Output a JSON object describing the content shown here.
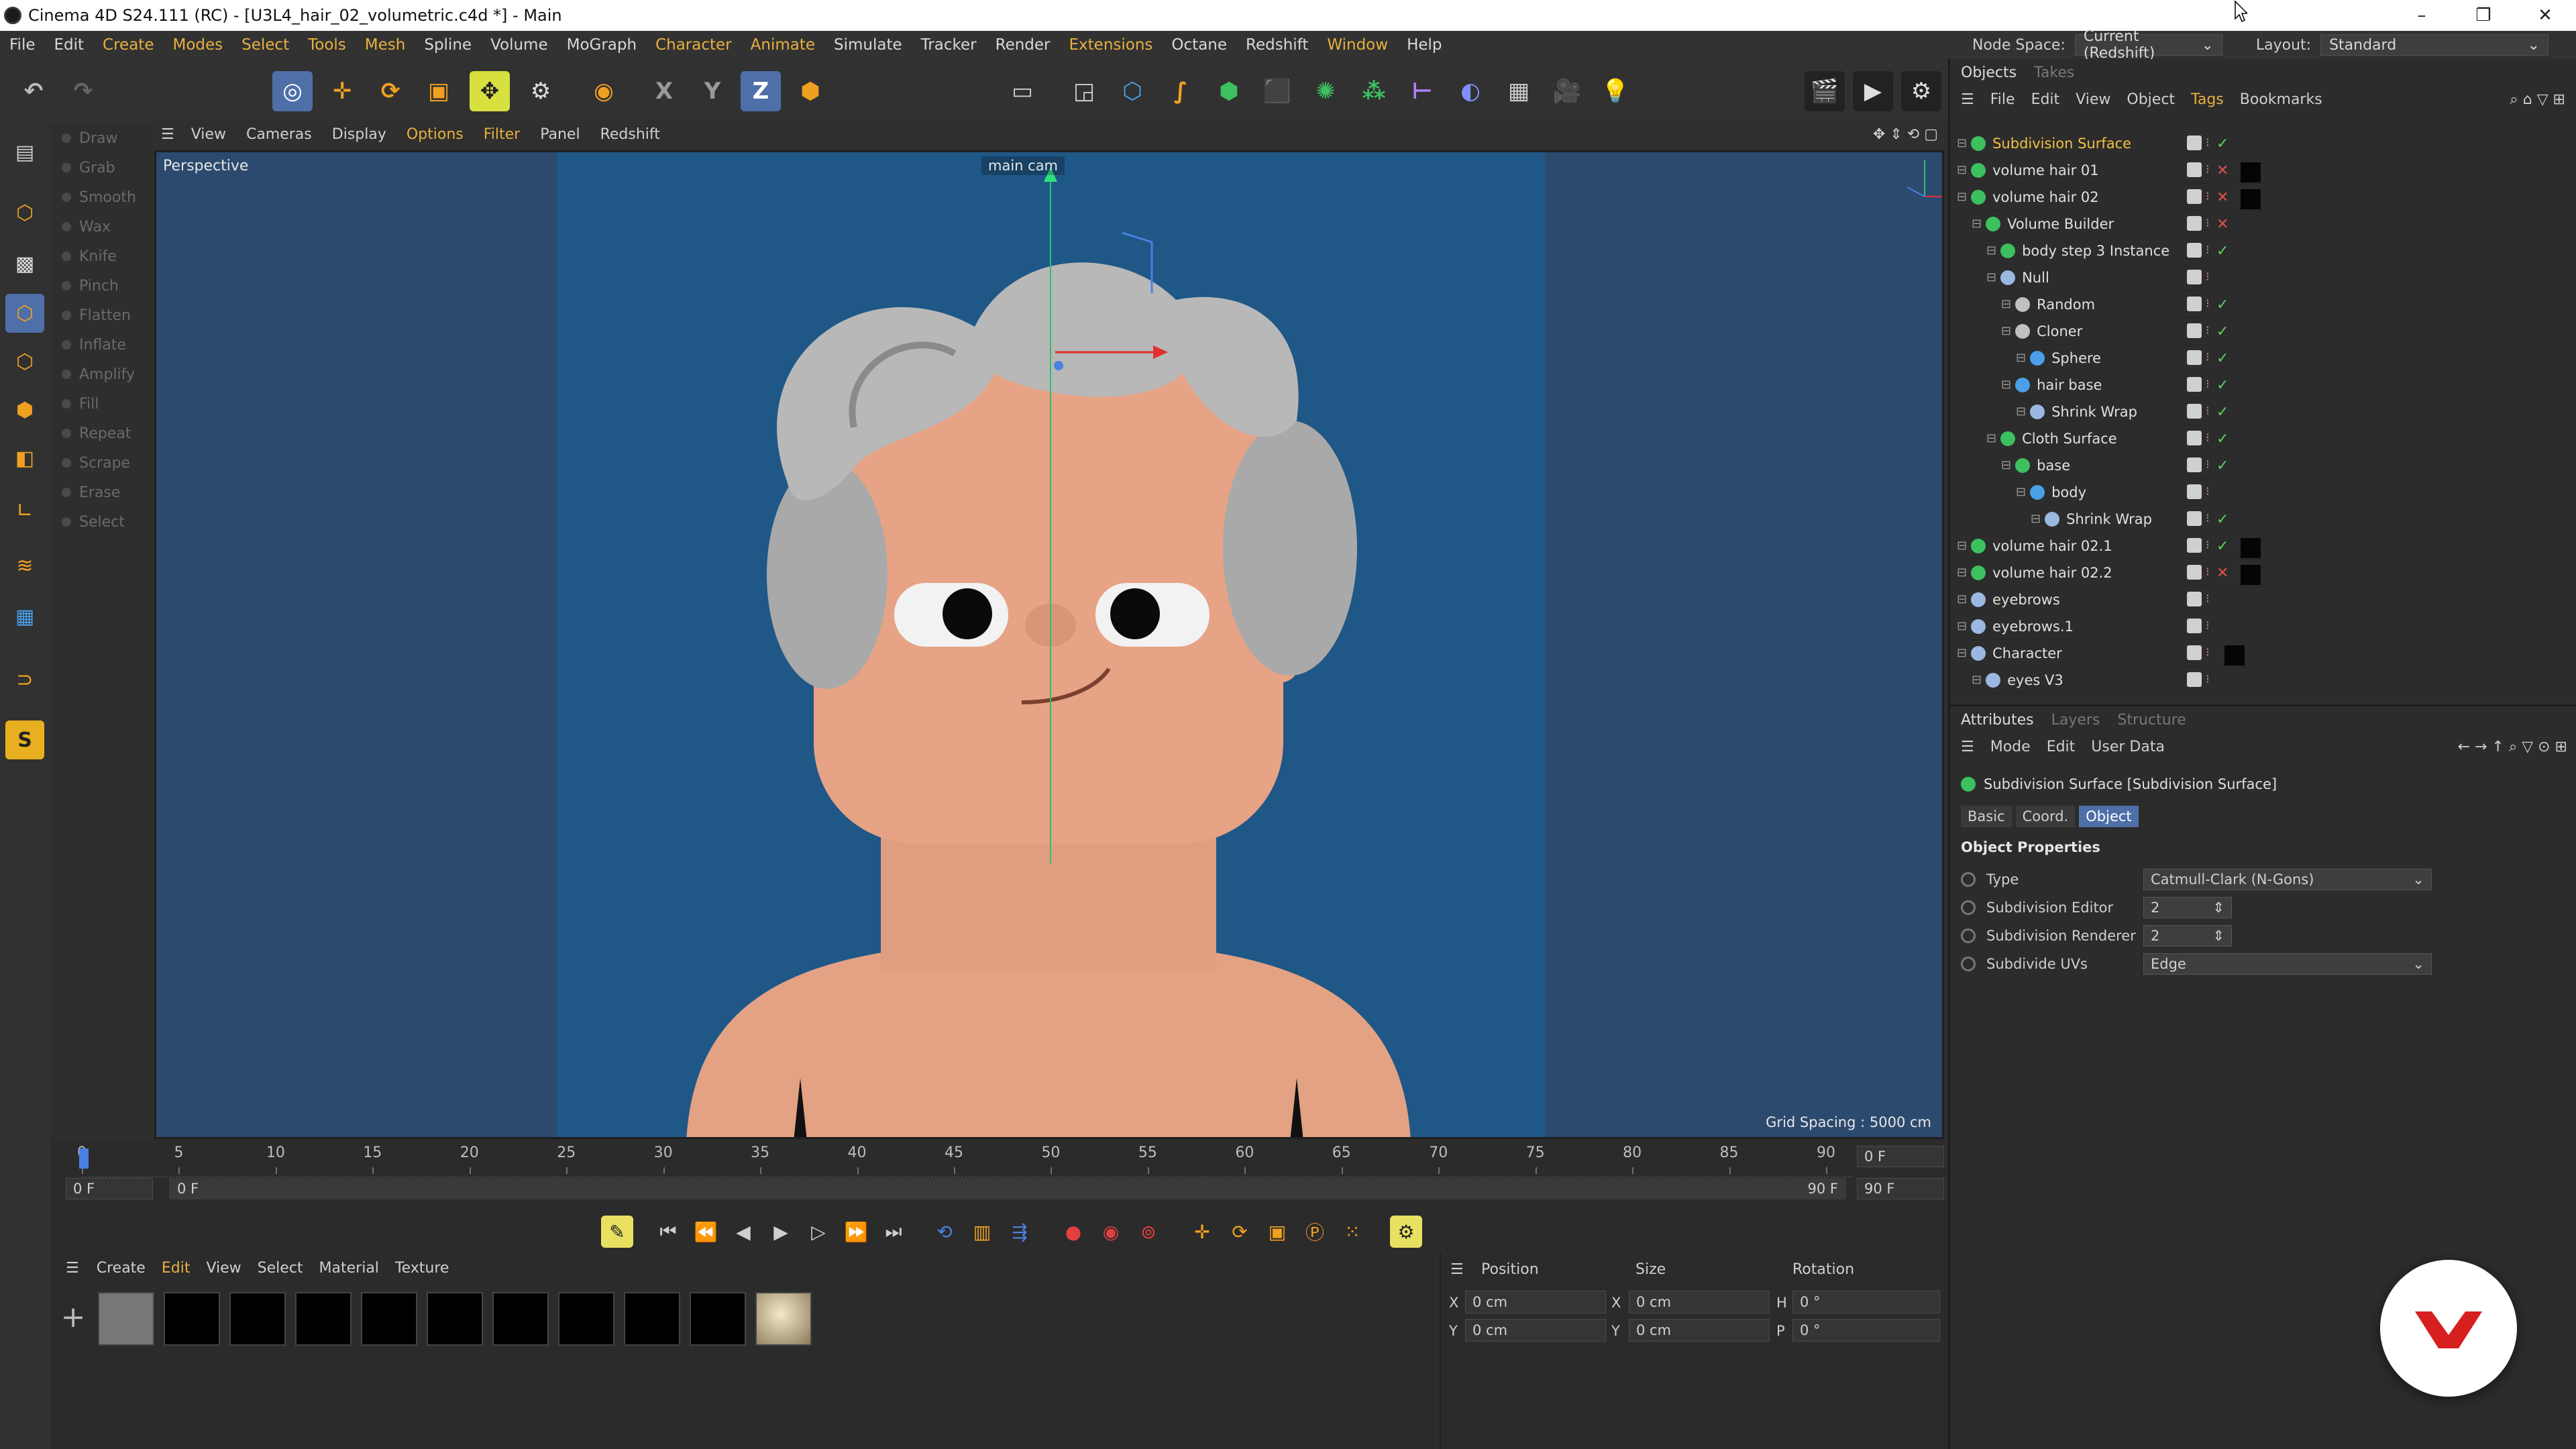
{
  "window": {
    "title": "Cinema 4D S24.111 (RC) - [U3L4_hair_02_volumetric.c4d *] - Main",
    "controls": [
      "–",
      "❐",
      "✕"
    ]
  },
  "menubar": {
    "items": [
      "File",
      "Edit",
      "Create",
      "Modes",
      "Select",
      "Tools",
      "Mesh",
      "Spline",
      "Volume",
      "MoGraph",
      "Character",
      "Animate",
      "Simulate",
      "Tracker",
      "Render",
      "Extensions",
      "Octane",
      "Redshift",
      "Window",
      "Help"
    ],
    "node_space_label": "Node Space:",
    "node_space_value": "Current (Redshift)",
    "layout_label": "Layout:",
    "layout_value": "Standard"
  },
  "sculpt_tools": [
    "Draw",
    "Grab",
    "Smooth",
    "Wax",
    "Knife",
    "Pinch",
    "Flatten",
    "Inflate",
    "Amplify",
    "Fill",
    "Repeat",
    "Scrape",
    "Erase",
    "Select"
  ],
  "viewport": {
    "menu": [
      "View",
      "Cameras",
      "Display",
      "Options",
      "Filter",
      "Panel",
      "Redshift"
    ],
    "label": "Perspective",
    "camera": "main cam",
    "grid_spacing": "Grid Spacing : 5000 cm"
  },
  "timeline": {
    "ticks": [
      "0",
      "5",
      "10",
      "15",
      "20",
      "25",
      "30",
      "35",
      "40",
      "45",
      "50",
      "55",
      "60",
      "65",
      "70",
      "75",
      "80",
      "85",
      "90"
    ],
    "current_frame": "0 F",
    "start_frame": "0 F",
    "range_start": "0 F",
    "range_end": "90 F",
    "end_frame": "90 F",
    "end_frame2": "90 F"
  },
  "material_manager": {
    "menu": [
      "Create",
      "Edit",
      "View",
      "Select",
      "Material",
      "Texture"
    ]
  },
  "coordinates": {
    "headers": [
      "Position",
      "Size",
      "Rotation"
    ],
    "rows": [
      {
        "axis": "X",
        "pos": "0 cm",
        "size_axis": "X",
        "size": "0 cm",
        "rot_axis": "H",
        "rot": "0 °"
      },
      {
        "axis": "Y",
        "pos": "0 cm",
        "size_axis": "Y",
        "size": "0 cm",
        "rot_axis": "P",
        "rot": "0 °"
      }
    ]
  },
  "objects_panel": {
    "tabs": [
      "Objects",
      "Takes"
    ],
    "menu": [
      "File",
      "Edit",
      "View",
      "Object",
      "Tags",
      "Bookmarks"
    ],
    "items": [
      {
        "name": "Subdivision Surface",
        "indent": 0,
        "color": "#3cc060",
        "highlight": true,
        "state": "check"
      },
      {
        "name": "volume hair 01",
        "indent": 0,
        "color": "#3cc060",
        "state": "cross",
        "tag": true
      },
      {
        "name": "volume hair 02",
        "indent": 0,
        "color": "#3cc060",
        "state": "cross",
        "tag": true
      },
      {
        "name": "Volume Builder",
        "indent": 1,
        "color": "#3cc060",
        "state": "cross"
      },
      {
        "name": "body step 3 Instance",
        "indent": 2,
        "color": "#3cc060",
        "state": "check"
      },
      {
        "name": "Null",
        "indent": 2,
        "color": "#9ab8e0",
        "state": ""
      },
      {
        "name": "Random",
        "indent": 3,
        "color": "#c0c0c0",
        "state": "check"
      },
      {
        "name": "Cloner",
        "indent": 3,
        "color": "#c0c0c0",
        "state": "check"
      },
      {
        "name": "Sphere",
        "indent": 4,
        "color": "#4aa0e8",
        "state": "check"
      },
      {
        "name": "hair base",
        "indent": 3,
        "color": "#4aa0e8",
        "state": "check"
      },
      {
        "name": "Shrink Wrap",
        "indent": 4,
        "color": "#9ab8e0",
        "state": "check"
      },
      {
        "name": "Cloth Surface",
        "indent": 2,
        "color": "#3cc060",
        "state": "check"
      },
      {
        "name": "base",
        "indent": 3,
        "color": "#3cc060",
        "state": "check"
      },
      {
        "name": "body",
        "indent": 4,
        "color": "#4aa0e8",
        "state": ""
      },
      {
        "name": "Shrink Wrap",
        "indent": 5,
        "color": "#9ab8e0",
        "state": "check"
      },
      {
        "name": "volume hair 02.1",
        "indent": 0,
        "color": "#3cc060",
        "state": "check",
        "tag": true
      },
      {
        "name": "volume hair 02.2",
        "indent": 0,
        "color": "#3cc060",
        "state": "cross",
        "tag": true
      },
      {
        "name": "eyebrows",
        "indent": 0,
        "color": "#9ab8e0",
        "state": ""
      },
      {
        "name": "eyebrows.1",
        "indent": 0,
        "color": "#9ab8e0",
        "state": ""
      },
      {
        "name": "Character",
        "indent": 0,
        "color": "#9ab8e0",
        "state": "",
        "tag": true
      },
      {
        "name": "eyes V3",
        "indent": 1,
        "color": "#9ab8e0",
        "state": ""
      }
    ]
  },
  "attributes": {
    "tabs": [
      "Attributes",
      "Layers",
      "Structure"
    ],
    "menu": [
      "Mode",
      "Edit",
      "User Data"
    ],
    "object_title": "Subdivision Surface [Subdivision Surface]",
    "subtabs": [
      "Basic",
      "Coord.",
      "Object"
    ],
    "group": "Object Properties",
    "properties": [
      {
        "label": "Type",
        "value": "Catmull-Clark (N-Gons)"
      },
      {
        "label": "Subdivision Editor",
        "value": "2"
      },
      {
        "label": "Subdivision Renderer",
        "value": "2"
      },
      {
        "label": "Subdivide UVs",
        "value": "Edge"
      }
    ]
  }
}
